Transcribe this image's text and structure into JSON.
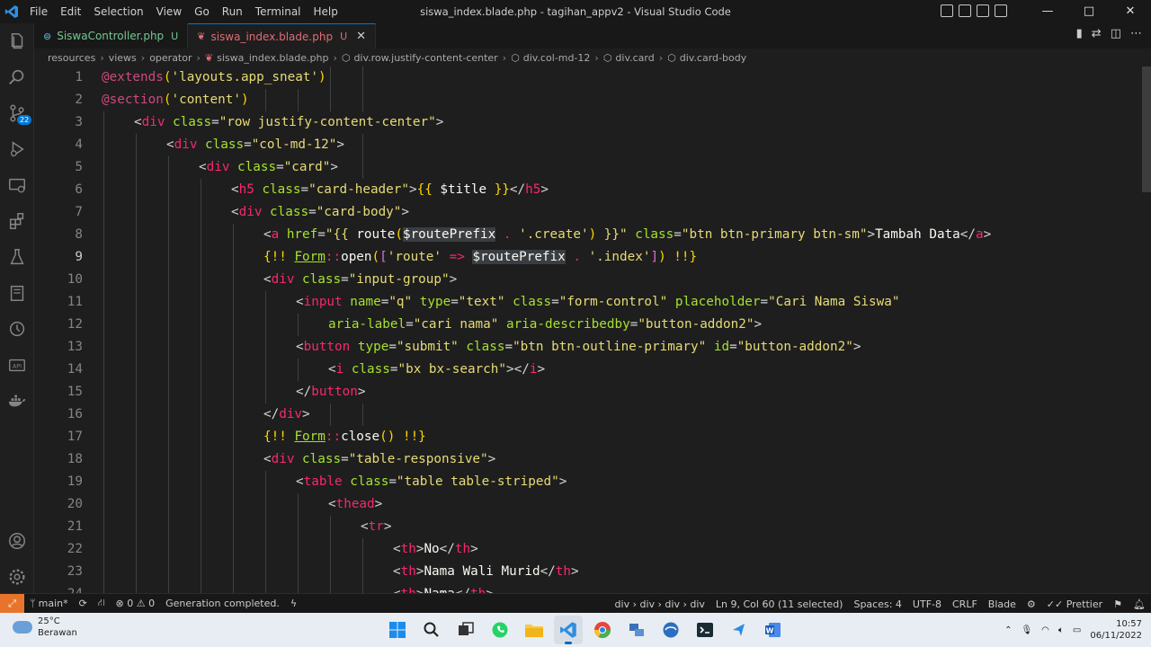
{
  "window": {
    "title": "siswa_index.blade.php - tagihan_appv2 - Visual Studio Code",
    "menu": [
      "File",
      "Edit",
      "Selection",
      "View",
      "Go",
      "Run",
      "Terminal",
      "Help"
    ],
    "controls": [
      "—",
      "□",
      "✕"
    ]
  },
  "activity_bar": {
    "items": [
      "explorer-icon",
      "search-icon",
      "source-control-icon",
      "run-debug-icon",
      "remote-explorer-icon",
      "extensions-icon",
      "testing-icon",
      "notebook-icon",
      "timeline-icon",
      "api-icon",
      "docker-icon",
      "accounts-icon",
      "manage-gear-icon"
    ],
    "source_control_badge": "22"
  },
  "tabs": [
    {
      "label": "SiswaController.php",
      "status": "U",
      "active": false
    },
    {
      "label": "siswa_index.blade.php",
      "status": "U",
      "active": true
    }
  ],
  "breadcrumb": [
    "resources",
    "views",
    "operator",
    "siswa_index.blade.php",
    "div.row.justify-content-center",
    "div.col-md-12",
    "div.card",
    "div.card-body"
  ],
  "editor": {
    "current_line": 9,
    "lines": [
      {
        "n": "1",
        "indent": 0,
        "tokens": [
          [
            "t-at",
            "@extends"
          ],
          [
            "t-br1",
            "("
          ],
          [
            "t-strb",
            "'layouts.app_sneat'"
          ],
          [
            "t-br1",
            ")"
          ]
        ]
      },
      {
        "n": "2",
        "indent": 0,
        "tokens": [
          [
            "t-at",
            "@section"
          ],
          [
            "t-br1",
            "("
          ],
          [
            "t-strb",
            "'content'"
          ],
          [
            "t-br1",
            ")"
          ]
        ]
      },
      {
        "n": "3",
        "indent": 1,
        "tokens": [
          [
            "t-pn",
            "<"
          ],
          [
            "t-tag",
            "div"
          ],
          [
            "t-pn",
            " "
          ],
          [
            "t-attr",
            "class"
          ],
          [
            "t-pn",
            "="
          ],
          [
            "t-val",
            "\"row justify-content-center\""
          ],
          [
            "t-pn",
            ">"
          ]
        ]
      },
      {
        "n": "4",
        "indent": 2,
        "tokens": [
          [
            "t-pn",
            "<"
          ],
          [
            "t-tag",
            "div"
          ],
          [
            "t-pn",
            " "
          ],
          [
            "t-attr",
            "class"
          ],
          [
            "t-pn",
            "="
          ],
          [
            "t-val",
            "\"col-md-12\""
          ],
          [
            "t-pn",
            ">"
          ]
        ]
      },
      {
        "n": "5",
        "indent": 3,
        "tokens": [
          [
            "t-pn",
            "<"
          ],
          [
            "t-tag",
            "div"
          ],
          [
            "t-pn",
            " "
          ],
          [
            "t-attr",
            "class"
          ],
          [
            "t-pn",
            "="
          ],
          [
            "t-val",
            "\"card\""
          ],
          [
            "t-pn",
            ">"
          ]
        ]
      },
      {
        "n": "6",
        "indent": 4,
        "tokens": [
          [
            "t-pn",
            "<"
          ],
          [
            "t-tag",
            "h5"
          ],
          [
            "t-pn",
            " "
          ],
          [
            "t-attr",
            "class"
          ],
          [
            "t-pn",
            "="
          ],
          [
            "t-val",
            "\"card-header\""
          ],
          [
            "t-pn",
            ">"
          ],
          [
            "t-br1",
            "{{"
          ],
          [
            "t-var",
            " $title "
          ],
          [
            "t-br1",
            "}}"
          ],
          [
            "t-pn",
            "</"
          ],
          [
            "t-tag",
            "h5"
          ],
          [
            "t-pn",
            ">"
          ]
        ]
      },
      {
        "n": "7",
        "indent": 4,
        "tokens": [
          [
            "t-pn",
            "<"
          ],
          [
            "t-tag",
            "div"
          ],
          [
            "t-pn",
            " "
          ],
          [
            "t-attr",
            "class"
          ],
          [
            "t-pn",
            "="
          ],
          [
            "t-val",
            "\"card-body\""
          ],
          [
            "t-pn",
            ">"
          ]
        ]
      },
      {
        "n": "8",
        "indent": 5,
        "tokens": [
          [
            "t-pn",
            "<"
          ],
          [
            "t-tag",
            "a"
          ],
          [
            "t-pn",
            " "
          ],
          [
            "t-attr",
            "href"
          ],
          [
            "t-pn",
            "="
          ],
          [
            "t-val",
            "\"{{ "
          ],
          [
            "t-fn",
            "route"
          ],
          [
            "t-br1",
            "("
          ],
          [
            "t-var",
            "$routePrefix"
          ],
          [
            "t-op",
            " . "
          ],
          [
            "t-val",
            "'.create'"
          ],
          [
            "t-br1",
            ")"
          ],
          [
            "t-val",
            " }}\""
          ],
          [
            "t-pn",
            " "
          ],
          [
            "t-attr",
            "class"
          ],
          [
            "t-pn",
            "="
          ],
          [
            "t-val",
            "\"btn btn-primary btn-sm\""
          ],
          [
            "t-pn",
            ">"
          ],
          [
            "t-txt",
            "Tambah Data"
          ],
          [
            "t-pn",
            "</"
          ],
          [
            "t-tag",
            "a"
          ],
          [
            "t-pn",
            ">"
          ]
        ]
      },
      {
        "n": "9",
        "indent": 5,
        "tokens": [
          [
            "t-br1",
            "{!!"
          ],
          [
            "t-pn",
            " "
          ],
          [
            "t-cls",
            "Form"
          ],
          [
            "t-op",
            "::"
          ],
          [
            "t-fn",
            "open"
          ],
          [
            "t-br1",
            "("
          ],
          [
            "t-br2",
            "["
          ],
          [
            "t-val",
            "'route'"
          ],
          [
            "t-op",
            " => "
          ],
          [
            "t-var",
            "$routePrefix"
          ],
          [
            "t-op",
            " . "
          ],
          [
            "t-val",
            "'.index'"
          ],
          [
            "t-br2",
            "]"
          ],
          [
            "t-br1",
            ")"
          ],
          [
            "t-pn",
            " "
          ],
          [
            "t-br1",
            "!!}"
          ]
        ]
      },
      {
        "n": "10",
        "indent": 5,
        "tokens": [
          [
            "t-pn",
            "<"
          ],
          [
            "t-tag",
            "div"
          ],
          [
            "t-pn",
            " "
          ],
          [
            "t-attr",
            "class"
          ],
          [
            "t-pn",
            "="
          ],
          [
            "t-val",
            "\"input-group\""
          ],
          [
            "t-pn",
            ">"
          ]
        ]
      },
      {
        "n": "11",
        "indent": 6,
        "tokens": [
          [
            "t-pn",
            "<"
          ],
          [
            "t-tag",
            "input"
          ],
          [
            "t-pn",
            " "
          ],
          [
            "t-attr",
            "name"
          ],
          [
            "t-pn",
            "="
          ],
          [
            "t-val",
            "\"q\""
          ],
          [
            "t-pn",
            " "
          ],
          [
            "t-attr",
            "type"
          ],
          [
            "t-pn",
            "="
          ],
          [
            "t-val",
            "\"text\""
          ],
          [
            "t-pn",
            " "
          ],
          [
            "t-attr",
            "class"
          ],
          [
            "t-pn",
            "="
          ],
          [
            "t-val",
            "\"form-control\""
          ],
          [
            "t-pn",
            " "
          ],
          [
            "t-attr",
            "placeholder"
          ],
          [
            "t-pn",
            "="
          ],
          [
            "t-val",
            "\"Cari Nama Siswa\""
          ]
        ]
      },
      {
        "n": "12",
        "indent": 7,
        "tokens": [
          [
            "t-attr",
            "aria-label"
          ],
          [
            "t-pn",
            "="
          ],
          [
            "t-val",
            "\"cari nama\""
          ],
          [
            "t-pn",
            " "
          ],
          [
            "t-attr",
            "aria-describedby"
          ],
          [
            "t-pn",
            "="
          ],
          [
            "t-val",
            "\"button-addon2\""
          ],
          [
            "t-pn",
            ">"
          ]
        ]
      },
      {
        "n": "13",
        "indent": 6,
        "tokens": [
          [
            "t-pn",
            "<"
          ],
          [
            "t-tag",
            "button"
          ],
          [
            "t-pn",
            " "
          ],
          [
            "t-attr",
            "type"
          ],
          [
            "t-pn",
            "="
          ],
          [
            "t-val",
            "\"submit\""
          ],
          [
            "t-pn",
            " "
          ],
          [
            "t-attr",
            "class"
          ],
          [
            "t-pn",
            "="
          ],
          [
            "t-val",
            "\"btn btn-outline-primary\""
          ],
          [
            "t-pn",
            " "
          ],
          [
            "t-attr",
            "id"
          ],
          [
            "t-pn",
            "="
          ],
          [
            "t-val",
            "\"button-addon2\""
          ],
          [
            "t-pn",
            ">"
          ]
        ]
      },
      {
        "n": "14",
        "indent": 7,
        "tokens": [
          [
            "t-pn",
            "<"
          ],
          [
            "t-tag",
            "i"
          ],
          [
            "t-pn",
            " "
          ],
          [
            "t-attr",
            "class"
          ],
          [
            "t-pn",
            "="
          ],
          [
            "t-val",
            "\"bx bx-search\""
          ],
          [
            "t-pn",
            "></"
          ],
          [
            "t-tag",
            "i"
          ],
          [
            "t-pn",
            ">"
          ]
        ]
      },
      {
        "n": "15",
        "indent": 6,
        "tokens": [
          [
            "t-pn",
            "</"
          ],
          [
            "t-tag",
            "button"
          ],
          [
            "t-pn",
            ">"
          ]
        ]
      },
      {
        "n": "16",
        "indent": 5,
        "tokens": [
          [
            "t-pn",
            "</"
          ],
          [
            "t-tag",
            "div"
          ],
          [
            "t-pn",
            ">"
          ]
        ]
      },
      {
        "n": "17",
        "indent": 5,
        "tokens": [
          [
            "t-br1",
            "{!!"
          ],
          [
            "t-pn",
            " "
          ],
          [
            "t-cls",
            "Form"
          ],
          [
            "t-op",
            "::"
          ],
          [
            "t-fn",
            "close"
          ],
          [
            "t-br1",
            "()"
          ],
          [
            "t-pn",
            " "
          ],
          [
            "t-br1",
            "!!}"
          ]
        ]
      },
      {
        "n": "18",
        "indent": 5,
        "tokens": [
          [
            "t-pn",
            "<"
          ],
          [
            "t-tag",
            "div"
          ],
          [
            "t-pn",
            " "
          ],
          [
            "t-attr",
            "class"
          ],
          [
            "t-pn",
            "="
          ],
          [
            "t-val",
            "\"table-responsive\""
          ],
          [
            "t-pn",
            ">"
          ]
        ]
      },
      {
        "n": "19",
        "indent": 6,
        "tokens": [
          [
            "t-pn",
            "<"
          ],
          [
            "t-tag",
            "table"
          ],
          [
            "t-pn",
            " "
          ],
          [
            "t-attr",
            "class"
          ],
          [
            "t-pn",
            "="
          ],
          [
            "t-val",
            "\"table table-striped\""
          ],
          [
            "t-pn",
            ">"
          ]
        ]
      },
      {
        "n": "20",
        "indent": 7,
        "tokens": [
          [
            "t-pn",
            "<"
          ],
          [
            "t-tag",
            "thead"
          ],
          [
            "t-pn",
            ">"
          ]
        ]
      },
      {
        "n": "21",
        "indent": 8,
        "tokens": [
          [
            "t-pn",
            "<"
          ],
          [
            "t-tag",
            "tr"
          ],
          [
            "t-pn",
            ">"
          ]
        ]
      },
      {
        "n": "22",
        "indent": 9,
        "tokens": [
          [
            "t-pn",
            "<"
          ],
          [
            "t-tag",
            "th"
          ],
          [
            "t-pn",
            ">"
          ],
          [
            "t-txt",
            "No"
          ],
          [
            "t-pn",
            "</"
          ],
          [
            "t-tag",
            "th"
          ],
          [
            "t-pn",
            ">"
          ]
        ]
      },
      {
        "n": "23",
        "indent": 9,
        "tokens": [
          [
            "t-pn",
            "<"
          ],
          [
            "t-tag",
            "th"
          ],
          [
            "t-pn",
            ">"
          ],
          [
            "t-txt",
            "Nama Wali Murid"
          ],
          [
            "t-pn",
            "</"
          ],
          [
            "t-tag",
            "th"
          ],
          [
            "t-pn",
            ">"
          ]
        ]
      },
      {
        "n": "24",
        "indent": 9,
        "tokens": [
          [
            "t-pn",
            "<"
          ],
          [
            "t-tag",
            "th"
          ],
          [
            "t-pn",
            ">"
          ],
          [
            "t-txt",
            "Nama"
          ],
          [
            "t-pn",
            "</"
          ],
          [
            "t-tag",
            "th"
          ],
          [
            "t-pn",
            ">"
          ]
        ]
      }
    ]
  },
  "statusbar": {
    "branch": "main*",
    "errors": "0",
    "warnings": "0",
    "message": "Generation completed.",
    "path": "div › div › div › div",
    "position": "Ln 9, Col 60 (11 selected)",
    "spaces": "Spaces: 4",
    "encoding": "UTF-8",
    "eol": "CRLF",
    "language": "Blade",
    "formatter": "Prettier"
  },
  "taskbar": {
    "weather_temp": "25°C",
    "weather_desc": "Berawan",
    "time": "10:57",
    "date": "06/11/2022",
    "apps": [
      "windows-start-icon",
      "search-icon",
      "task-view-icon",
      "whatsapp-icon",
      "file-explorer-icon",
      "vscode-icon",
      "chrome-icon",
      "network-app-icon",
      "browser-app-icon",
      "terminal-icon",
      "arrow-app-icon",
      "word-icon"
    ]
  }
}
